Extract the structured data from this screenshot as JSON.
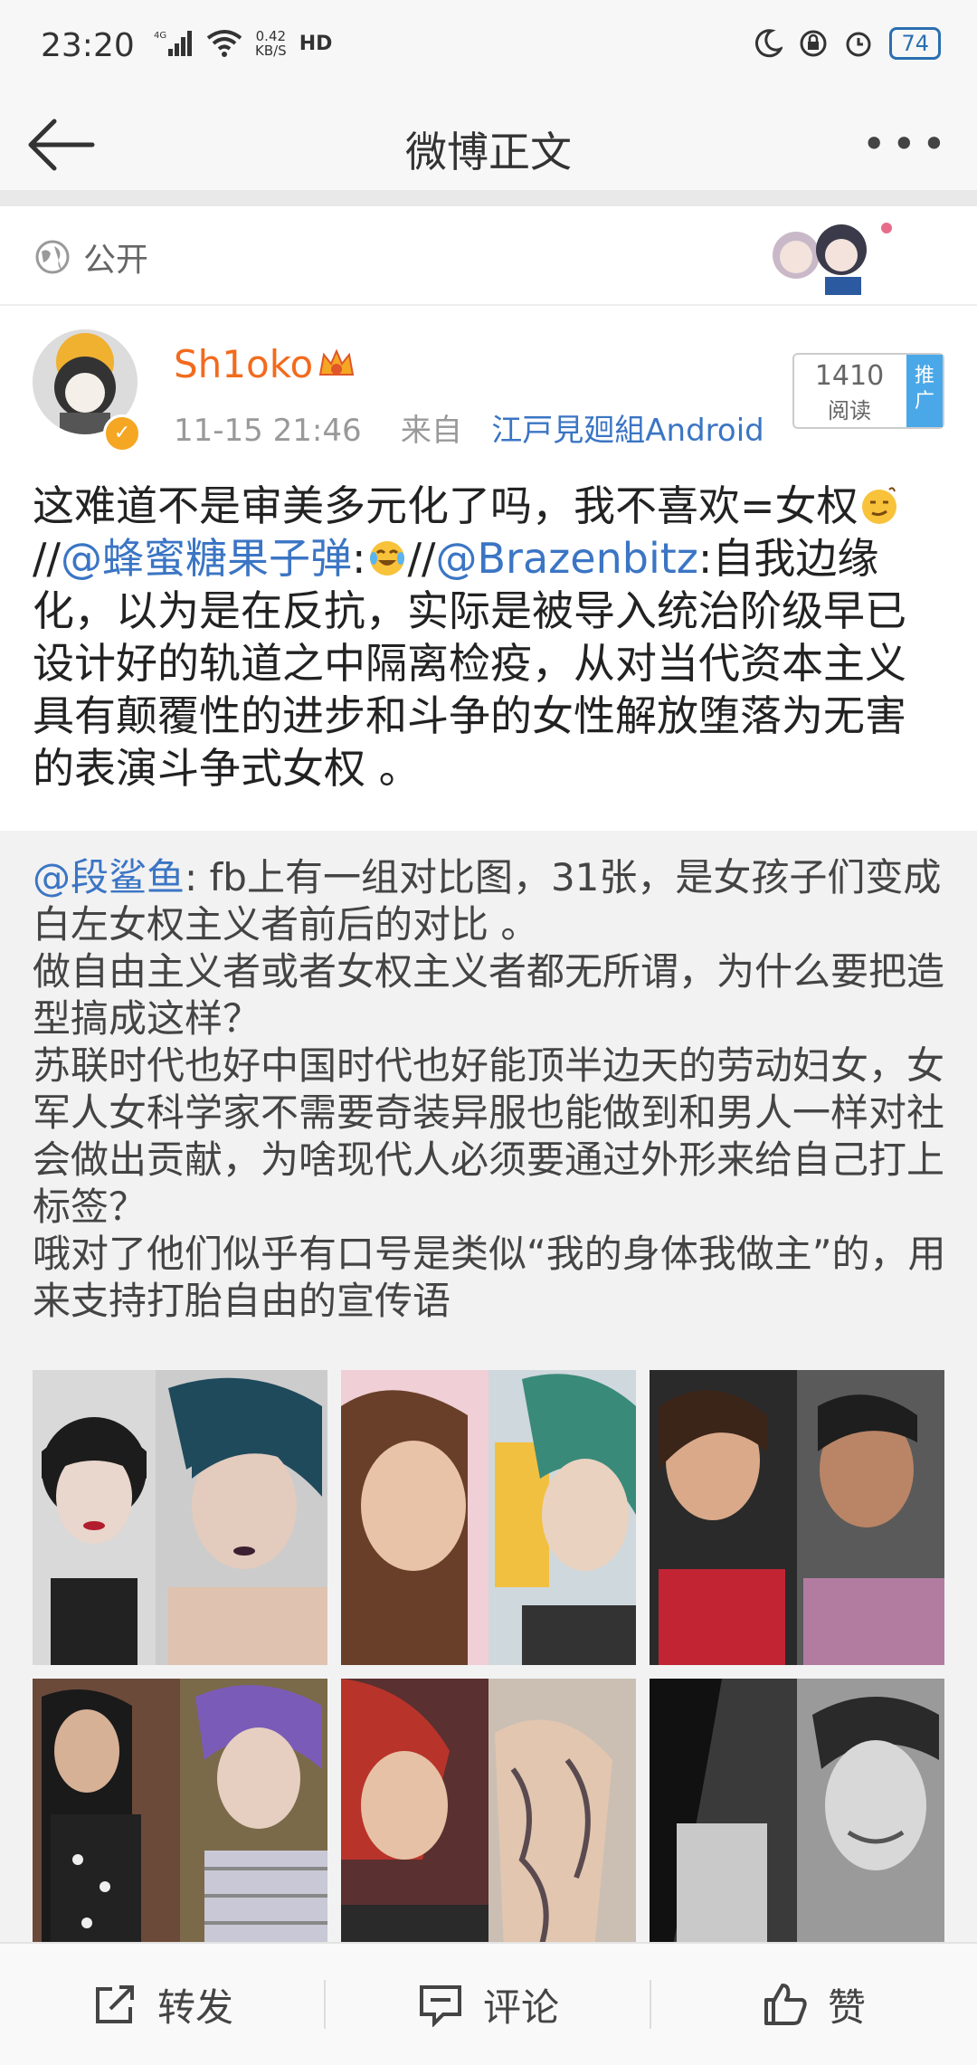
{
  "status_bar": {
    "time": "23:20",
    "net_type": "4G",
    "speed_value": "0.42",
    "speed_unit": "KB/S",
    "hd": "HD",
    "battery": "74"
  },
  "header": {
    "title": "微博正文"
  },
  "visibility": {
    "label": "公开"
  },
  "post": {
    "username": "Sh1oko",
    "timestamp": "11-15 21:46",
    "source_prefix": "来自",
    "source": "江戸見廻組Android",
    "read_count": "1410",
    "read_label": "阅读",
    "promote_label": "推广",
    "text_part1": "这难道不是审美多元化了吗，我不喜欢=女权",
    "sep1": "//",
    "mention1": "@蜂蜜糖果子弹",
    "colon1": ":",
    "sep2": "//",
    "mention2": "@Brazenbitz",
    "text_part2": ":自我边缘化，以为是在反抗，实际是被导入统治阶级早已设计好的轨道之中隔离检疫，从对当代资本主义具有颠覆性的进步和斗争的女性解放堕落为无害的表演斗争式女权 。"
  },
  "repost": {
    "author": "@段鲨鱼",
    "text": ": fb上有一组对比图，31张，是女孩子们变成白左女权主义者前后的对比 。\n做自由主义者或者女权主义者都无所谓，为什么要把造型搞成这样？\n苏联时代也好中国时代也好能顶半边天的劳动妇女，女军人女科学家不需要奇装异服也能做到和男人一样对社会做出贡献，为啥现代人必须要通过外形来给自己打上标签？\n哦对了他们似乎有口号是类似“我的身体我做主”的，用来支持打胎自由的宣传语"
  },
  "images": [
    {
      "name": "photo-1"
    },
    {
      "name": "photo-2"
    },
    {
      "name": "photo-3"
    },
    {
      "name": "photo-4"
    },
    {
      "name": "photo-5"
    },
    {
      "name": "photo-6"
    }
  ],
  "actions": {
    "repost_label": "转发",
    "comment_label": "评论",
    "like_label": "赞"
  },
  "colors": {
    "username": "#f26b1d",
    "link": "#3b75c4",
    "promo": "#4aa8e8"
  }
}
